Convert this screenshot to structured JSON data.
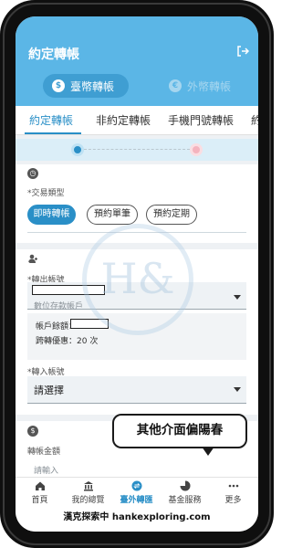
{
  "header": {
    "title": "約定轉帳"
  },
  "currency_tabs": [
    {
      "label": "臺幣轉帳",
      "symbol": "$"
    },
    {
      "label": "外幣轉帳",
      "symbol": "€"
    }
  ],
  "transfer_tabs": [
    "約定轉帳",
    "非約定轉帳",
    "手機門號轉帳",
    "約"
  ],
  "transaction_type": {
    "label": "*交易類型",
    "options": [
      "即時轉帳",
      "預約單筆",
      "預約定期"
    ],
    "selected": "即時轉帳"
  },
  "from_account": {
    "label": "*轉出帳號",
    "placeholder": "數位存款帳戶",
    "balance_label": "帳戶餘額：",
    "fee_waiver_label": "跨轉優惠：20 次"
  },
  "to_account": {
    "label": "*轉入帳號",
    "placeholder": "請選擇"
  },
  "amount": {
    "label": "轉帳金額",
    "placeholder": "請輸入"
  },
  "bottom_nav": [
    {
      "label": "首頁",
      "icon": "home-icon"
    },
    {
      "label": "我的總覽",
      "icon": "bank-icon"
    },
    {
      "label": "臺外轉匯",
      "icon": "transfer-icon",
      "active": true
    },
    {
      "label": "基金服務",
      "icon": "pie-chart-icon"
    },
    {
      "label": "更多",
      "icon": "more-icon"
    }
  ],
  "annotation": {
    "bubble_text": "其他介面偏陽春"
  },
  "footer": {
    "text": "漢克探索中 hankexploring.com"
  },
  "watermark": {
    "text": "H&"
  },
  "colors": {
    "primary": "#2a8fc7",
    "header": "#5bb6e6"
  }
}
